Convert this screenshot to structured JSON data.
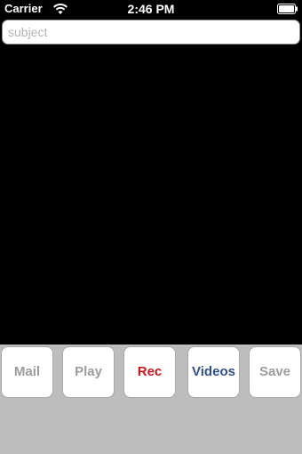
{
  "status_bar": {
    "carrier": "Carrier",
    "time": "2:46 PM",
    "wifi_icon": "wifi-icon",
    "battery_icon": "battery-icon"
  },
  "subject": {
    "placeholder": "subject",
    "value": ""
  },
  "buttons": {
    "mail": "Mail",
    "play": "Play",
    "rec": "Rec",
    "videos": "Videos",
    "save": "Save"
  },
  "colors": {
    "disabled_text": "#9b9b9b",
    "rec_text": "#c8161d",
    "videos_text": "#324f85",
    "bottom_background": "#bdbdbd",
    "preview_background": "#000000"
  }
}
